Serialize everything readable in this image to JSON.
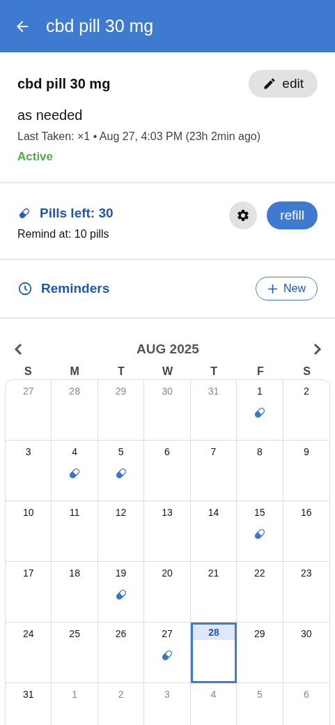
{
  "header": {
    "title": "cbd pill 30 mg"
  },
  "medication": {
    "name": "cbd pill 30 mg",
    "edit_label": "edit",
    "schedule": "as needed",
    "last_taken": "Last Taken: ×1 • Aug 27, 4:03 PM (23h 2min ago)",
    "status": "Active"
  },
  "pills": {
    "title": "Pills left: 30",
    "remind_at": "Remind at: 10 pills",
    "refill_label": "refill"
  },
  "reminders": {
    "title": "Reminders",
    "new_label": "New"
  },
  "calendar": {
    "month": "AUG 2025",
    "weekdays": [
      "S",
      "M",
      "T",
      "W",
      "T",
      "F",
      "S"
    ],
    "days": [
      {
        "day": "27",
        "outside": true,
        "taken": false,
        "selected": false
      },
      {
        "day": "28",
        "outside": true,
        "taken": false,
        "selected": false
      },
      {
        "day": "29",
        "outside": true,
        "taken": false,
        "selected": false
      },
      {
        "day": "30",
        "outside": true,
        "taken": false,
        "selected": false
      },
      {
        "day": "31",
        "outside": true,
        "taken": false,
        "selected": false
      },
      {
        "day": "1",
        "outside": false,
        "taken": true,
        "selected": false
      },
      {
        "day": "2",
        "outside": false,
        "taken": false,
        "selected": false
      },
      {
        "day": "3",
        "outside": false,
        "taken": false,
        "selected": false
      },
      {
        "day": "4",
        "outside": false,
        "taken": true,
        "selected": false
      },
      {
        "day": "5",
        "outside": false,
        "taken": true,
        "selected": false
      },
      {
        "day": "6",
        "outside": false,
        "taken": false,
        "selected": false
      },
      {
        "day": "7",
        "outside": false,
        "taken": false,
        "selected": false
      },
      {
        "day": "8",
        "outside": false,
        "taken": false,
        "selected": false
      },
      {
        "day": "9",
        "outside": false,
        "taken": false,
        "selected": false
      },
      {
        "day": "10",
        "outside": false,
        "taken": false,
        "selected": false
      },
      {
        "day": "11",
        "outside": false,
        "taken": false,
        "selected": false
      },
      {
        "day": "12",
        "outside": false,
        "taken": false,
        "selected": false
      },
      {
        "day": "13",
        "outside": false,
        "taken": false,
        "selected": false
      },
      {
        "day": "14",
        "outside": false,
        "taken": false,
        "selected": false
      },
      {
        "day": "15",
        "outside": false,
        "taken": true,
        "selected": false
      },
      {
        "day": "16",
        "outside": false,
        "taken": false,
        "selected": false
      },
      {
        "day": "17",
        "outside": false,
        "taken": false,
        "selected": false
      },
      {
        "day": "18",
        "outside": false,
        "taken": false,
        "selected": false
      },
      {
        "day": "19",
        "outside": false,
        "taken": true,
        "selected": false
      },
      {
        "day": "20",
        "outside": false,
        "taken": false,
        "selected": false
      },
      {
        "day": "21",
        "outside": false,
        "taken": false,
        "selected": false
      },
      {
        "day": "22",
        "outside": false,
        "taken": false,
        "selected": false
      },
      {
        "day": "23",
        "outside": false,
        "taken": false,
        "selected": false
      },
      {
        "day": "24",
        "outside": false,
        "taken": false,
        "selected": false
      },
      {
        "day": "25",
        "outside": false,
        "taken": false,
        "selected": false
      },
      {
        "day": "26",
        "outside": false,
        "taken": false,
        "selected": false
      },
      {
        "day": "27",
        "outside": false,
        "taken": true,
        "selected": false
      },
      {
        "day": "28",
        "outside": false,
        "taken": false,
        "selected": true
      },
      {
        "day": "29",
        "outside": false,
        "taken": false,
        "selected": false
      },
      {
        "day": "30",
        "outside": false,
        "taken": false,
        "selected": false
      },
      {
        "day": "31",
        "outside": false,
        "taken": false,
        "selected": false
      },
      {
        "day": "1",
        "outside": true,
        "taken": false,
        "selected": false
      },
      {
        "day": "2",
        "outside": true,
        "taken": false,
        "selected": false
      },
      {
        "day": "3",
        "outside": true,
        "taken": false,
        "selected": false
      },
      {
        "day": "4",
        "outside": true,
        "taken": false,
        "selected": false
      },
      {
        "day": "5",
        "outside": true,
        "taken": false,
        "selected": false
      },
      {
        "day": "6",
        "outside": true,
        "taken": false,
        "selected": false
      }
    ]
  }
}
